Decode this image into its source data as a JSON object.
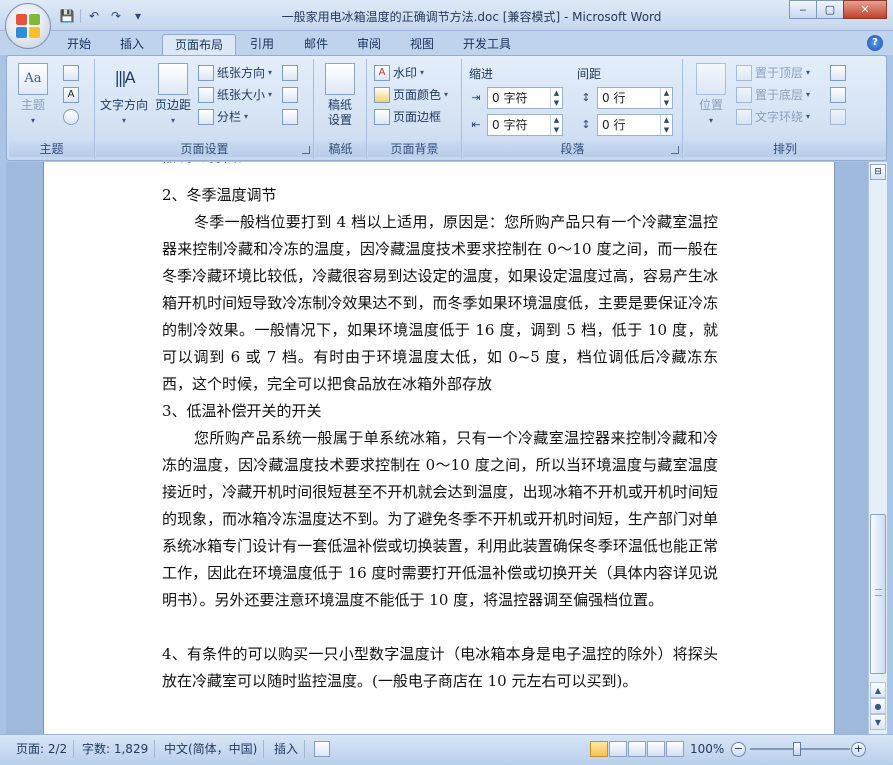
{
  "window": {
    "title": "一般家用电冰箱温度的正确调节方法.doc [兼容模式] - Microsoft Word",
    "minimize": "‒",
    "restore": "▢",
    "close": "✕"
  },
  "qat": {
    "save": "💾",
    "undo": "↶",
    "redo": "↷",
    "more": "▾"
  },
  "tabs": [
    "开始",
    "插入",
    "页面布局",
    "引用",
    "邮件",
    "审阅",
    "视图",
    "开发工具"
  ],
  "active_tab": "页面布局",
  "help": "?",
  "ribbon": {
    "theme": {
      "label": "主题",
      "btn": "主题"
    },
    "page_setup": {
      "label": "页面设置",
      "text_direction": "文字方向",
      "margins": "页边距",
      "orientation": "纸张方向",
      "size": "纸张大小",
      "columns": "分栏"
    },
    "draft": {
      "label": "稿纸",
      "btn_line1": "稿纸",
      "btn_line2": "设置"
    },
    "page_bg": {
      "label": "页面背景",
      "watermark": "水印",
      "page_color": "页面颜色",
      "page_border": "页面边框"
    },
    "paragraph": {
      "label": "段落",
      "indent_label": "缩进",
      "spacing_label": "间距",
      "indent_left": "0 字符",
      "indent_right": "0 字符",
      "spacing_before": "0 行",
      "spacing_after": "0 行"
    },
    "arrange": {
      "label": "排列",
      "position": "位置",
      "bring_front": "置于顶层",
      "send_back": "置于底层",
      "text_wrap": "文字环绕"
    }
  },
  "document": {
    "cut_line": "器调到弱档。",
    "h2": "2、冬季温度调节",
    "p2": "冬季一般档位要打到 4 档以上适用，原因是：您所购产品只有一个冷藏室温控器来控制冷藏和冷冻的温度，因冷藏温度技术要求控制在 0～10 度之间，而一般在冬季冷藏环境比较低，冷藏很容易到达设定的温度，如果设定温度过高，容易产生冰箱开机时间短导致冷冻制冷效果达不到，而冬季如果环境温度低，主要是要保证冷冻的制冷效果。一般情况下，如果环境温度低于 16 度，调到 5 档，低于 10 度，就可以调到 6 或 7 档。有时由于环境温度太低，如 0~5 度，档位调低后冷藏冻东西，这个时候，完全可以把食品放在冰箱外部存放",
    "h3": "3、低温补偿开关的开关",
    "p3": "您所购产品系统一般属于单系统冰箱，只有一个冷藏室温控器来控制冷藏和冷冻的温度，因冷藏温度技术要求控制在 0～10 度之间，所以当环境温度与藏室温度接近时，冷藏开机时间很短甚至不开机就会达到温度，出现冰箱不开机或开机时间短的现象，而冰箱冷冻温度达不到。为了避免冬季不开机或开机时间短，生产部门对单系统冰箱专门设计有一套低温补偿或切换装置，利用此装置确保冬季环温低也能正常工作，因此在环境温度低于 16 度时需要打开低温补偿或切换开关（具体内容详见说明书）。另外还要注意环境温度不能低于 10 度，将温控器调至偏强档位置。",
    "p4": "4、有条件的可以购买一只小型数字温度计（电冰箱本身是电子温控的除外）将探头放在冷藏室可以随时监控温度。(一般电子商店在 10 元左右可以买到)。"
  },
  "statusbar": {
    "page": "页面: 2/2",
    "words": "字数: 1,829",
    "language": "中文(简体，中国)",
    "mode": "插入",
    "zoom": "100%",
    "zoom_out": "−",
    "zoom_in": "+"
  },
  "colors": {
    "ribbon_bg": "#dce8f6",
    "accent": "#2b579a",
    "page": "#ffffff"
  }
}
